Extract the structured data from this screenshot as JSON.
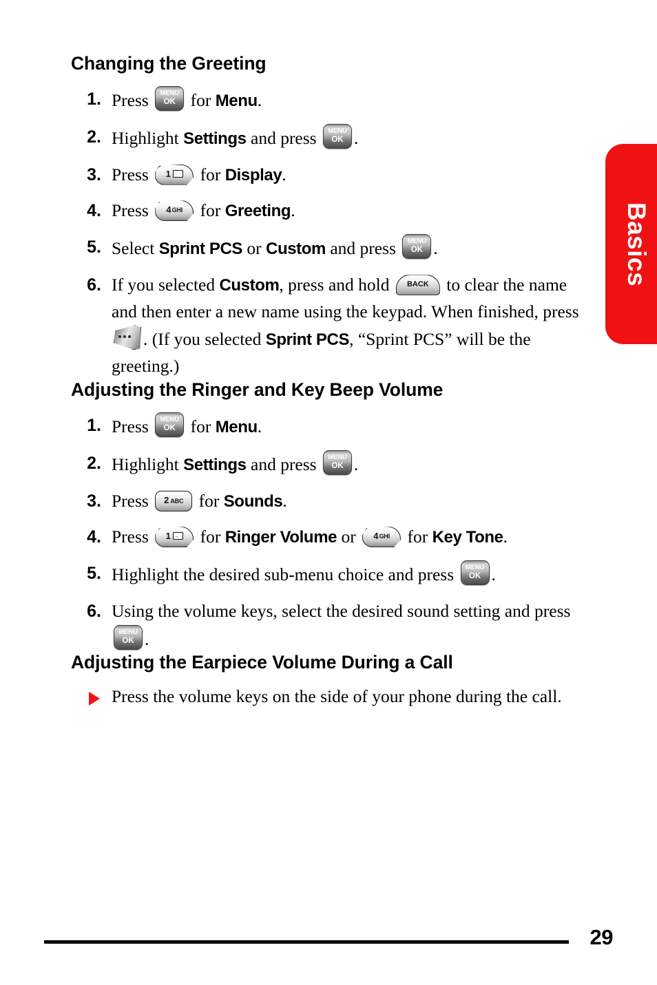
{
  "page": {
    "number": "29",
    "side_tab_label": "Basics",
    "accent_color": "#f01212"
  },
  "sections": [
    {
      "heading": "Changing the Greeting",
      "steps": [
        {
          "num": "1.",
          "parts": [
            {
              "t": "text",
              "v": "Press "
            },
            {
              "t": "key",
              "key": "menu-ok"
            },
            {
              "t": "text",
              "v": " for "
            },
            {
              "t": "bold",
              "v": "Menu"
            },
            {
              "t": "text",
              "v": "."
            }
          ]
        },
        {
          "num": "2.",
          "parts": [
            {
              "t": "text",
              "v": "Highlight "
            },
            {
              "t": "bold",
              "v": "Settings"
            },
            {
              "t": "text",
              "v": " and press "
            },
            {
              "t": "key",
              "key": "menu-ok"
            },
            {
              "t": "text",
              "v": "."
            }
          ]
        },
        {
          "num": "3.",
          "parts": [
            {
              "t": "text",
              "v": "Press "
            },
            {
              "t": "key",
              "key": "num-1"
            },
            {
              "t": "text",
              "v": " for "
            },
            {
              "t": "bold",
              "v": "Display"
            },
            {
              "t": "text",
              "v": "."
            }
          ]
        },
        {
          "num": "4.",
          "parts": [
            {
              "t": "text",
              "v": "Press "
            },
            {
              "t": "key",
              "key": "num-4"
            },
            {
              "t": "text",
              "v": " for "
            },
            {
              "t": "bold",
              "v": "Greeting"
            },
            {
              "t": "text",
              "v": "."
            }
          ]
        },
        {
          "num": "5.",
          "parts": [
            {
              "t": "text",
              "v": "Select "
            },
            {
              "t": "bold",
              "v": "Sprint PCS"
            },
            {
              "t": "text",
              "v": " or "
            },
            {
              "t": "bold",
              "v": "Custom"
            },
            {
              "t": "text",
              "v": " and press "
            },
            {
              "t": "key",
              "key": "menu-ok"
            },
            {
              "t": "text",
              "v": "."
            }
          ]
        },
        {
          "num": "6.",
          "parts": [
            {
              "t": "text",
              "v": "If you selected "
            },
            {
              "t": "bold",
              "v": "Custom"
            },
            {
              "t": "text",
              "v": ", press and hold "
            },
            {
              "t": "key",
              "key": "back"
            },
            {
              "t": "text",
              "v": " to clear the name and then enter a new name using the keypad. When finished, press "
            },
            {
              "t": "key",
              "key": "soft"
            },
            {
              "t": "text",
              "v": ". (If you selected "
            },
            {
              "t": "bold",
              "v": "Sprint PCS"
            },
            {
              "t": "text",
              "v": ", “Sprint PCS” will be the greeting.)"
            }
          ]
        }
      ]
    },
    {
      "heading": "Adjusting the Ringer and Key Beep Volume",
      "steps": [
        {
          "num": "1.",
          "parts": [
            {
              "t": "text",
              "v": "Press "
            },
            {
              "t": "key",
              "key": "menu-ok"
            },
            {
              "t": "text",
              "v": " for "
            },
            {
              "t": "bold",
              "v": "Menu"
            },
            {
              "t": "text",
              "v": "."
            }
          ]
        },
        {
          "num": "2.",
          "parts": [
            {
              "t": "text",
              "v": "Highlight "
            },
            {
              "t": "bold",
              "v": "Settings"
            },
            {
              "t": "text",
              "v": " and press "
            },
            {
              "t": "key",
              "key": "menu-ok"
            },
            {
              "t": "text",
              "v": "."
            }
          ]
        },
        {
          "num": "3.",
          "parts": [
            {
              "t": "text",
              "v": "Press "
            },
            {
              "t": "key",
              "key": "num-2"
            },
            {
              "t": "text",
              "v": " for "
            },
            {
              "t": "bold",
              "v": "Sounds"
            },
            {
              "t": "text",
              "v": "."
            }
          ]
        },
        {
          "num": "4.",
          "parts": [
            {
              "t": "text",
              "v": "Press "
            },
            {
              "t": "key",
              "key": "num-1"
            },
            {
              "t": "text",
              "v": " for "
            },
            {
              "t": "bold",
              "v": "Ringer Volume"
            },
            {
              "t": "text",
              "v": " or "
            },
            {
              "t": "key",
              "key": "num-4"
            },
            {
              "t": "text",
              "v": " for "
            },
            {
              "t": "bold",
              "v": "Key Tone"
            },
            {
              "t": "text",
              "v": "."
            }
          ]
        },
        {
          "num": "5.",
          "parts": [
            {
              "t": "text",
              "v": "Highlight the desired sub-menu choice and press "
            },
            {
              "t": "key",
              "key": "menu-ok"
            },
            {
              "t": "text",
              "v": "."
            }
          ]
        },
        {
          "num": "6.",
          "parts": [
            {
              "t": "text",
              "v": "Using the volume keys, select the desired sound setting and press "
            },
            {
              "t": "key",
              "key": "menu-ok"
            },
            {
              "t": "text",
              "v": "."
            }
          ]
        }
      ]
    },
    {
      "heading": "Adjusting the Earpiece Volume During a Call",
      "bullets": [
        {
          "parts": [
            {
              "t": "text",
              "v": "Press the volume keys on the side of your phone during the call."
            }
          ]
        }
      ]
    }
  ],
  "keys": {
    "menu-ok": {
      "name": "menu-ok-key",
      "line1": "MENU",
      "line2": "OK"
    },
    "num-1": {
      "name": "number-1-key",
      "digit": "1",
      "letters": "",
      "glyph": "envelope"
    },
    "num-2": {
      "name": "number-2-key",
      "digit": "2",
      "letters": "ABC",
      "glyph": ""
    },
    "num-4": {
      "name": "number-4-key",
      "digit": "4",
      "letters": "GHI",
      "glyph": ""
    },
    "back": {
      "name": "back-key",
      "label": "BACK"
    },
    "soft": {
      "name": "soft-key",
      "label": ""
    }
  }
}
